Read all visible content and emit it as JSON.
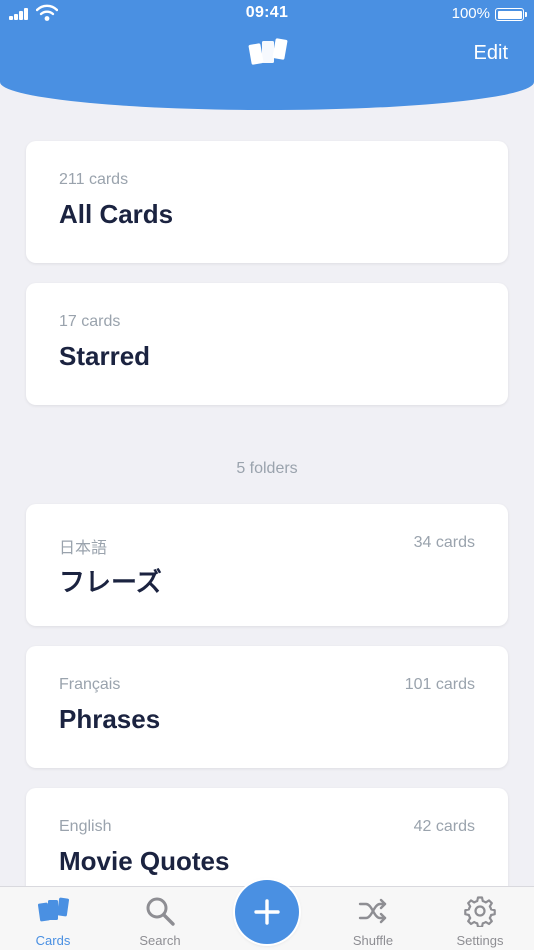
{
  "status_bar": {
    "time": "09:41",
    "battery": "100%"
  },
  "header": {
    "logo_icon": "cards-stack-icon",
    "edit_label": "Edit"
  },
  "collections": [
    {
      "subtitle": "211 cards",
      "title": "All Cards"
    },
    {
      "subtitle": "17 cards",
      "title": "Starred"
    }
  ],
  "folders_heading": "5 folders",
  "folders": [
    {
      "language": "日本語",
      "count": "34 cards",
      "title": "フレーズ"
    },
    {
      "language": "Français",
      "count": "101 cards",
      "title": "Phrases"
    },
    {
      "language": "English",
      "count": "42 cards",
      "title": "Movie Quotes"
    }
  ],
  "tab_bar": {
    "tabs": [
      {
        "label": "Cards",
        "icon": "cards-icon",
        "active": true
      },
      {
        "label": "Search",
        "icon": "search-icon",
        "active": false
      },
      {
        "label": "Shuffle",
        "icon": "shuffle-icon",
        "active": false
      },
      {
        "label": "Settings",
        "icon": "gear-icon",
        "active": false
      }
    ],
    "add_icon": "plus-icon"
  },
  "colors": {
    "accent": "#4a90e2",
    "background": "#f0f0f5",
    "title_text": "#1b2340",
    "muted_text": "#9aa3ad"
  }
}
